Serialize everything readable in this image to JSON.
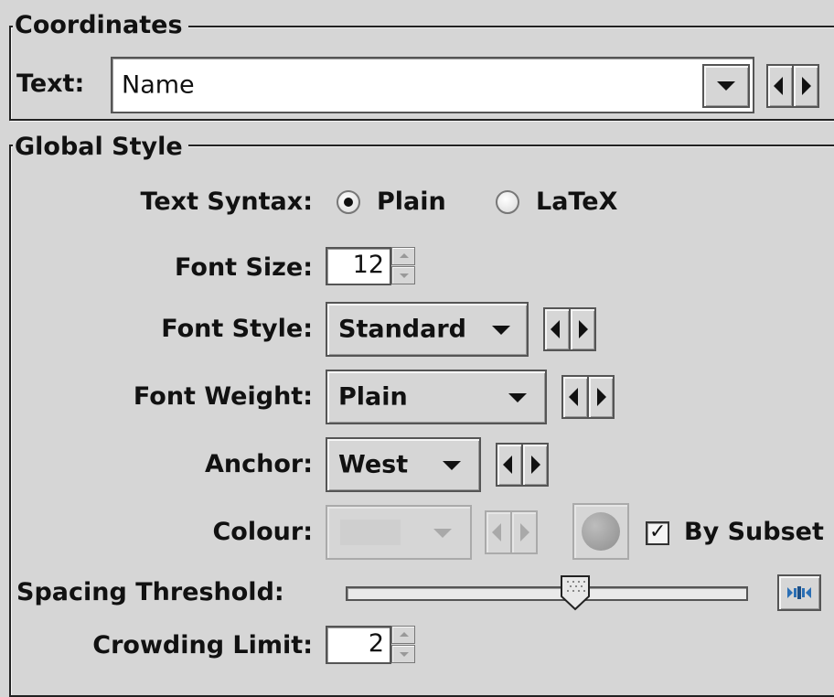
{
  "coordinates": {
    "legend": "Coordinates",
    "text_label": "Text:",
    "text_value": "Name"
  },
  "global_style": {
    "legend": "Global Style",
    "text_syntax": {
      "label": "Text Syntax:",
      "options": [
        {
          "label": "Plain",
          "selected": true
        },
        {
          "label": "LaTeX",
          "selected": false
        }
      ]
    },
    "font_size": {
      "label": "Font Size:",
      "value": "12"
    },
    "font_style": {
      "label": "Font Style:",
      "value": "Standard"
    },
    "font_weight": {
      "label": "Font Weight:",
      "value": "Plain"
    },
    "anchor": {
      "label": "Anchor:",
      "value": "West"
    },
    "colour": {
      "label": "Colour:",
      "enabled": false,
      "by_subset_label": "By Subset",
      "by_subset_checked": true
    },
    "spacing_threshold": {
      "label": "Spacing Threshold:",
      "slider_fraction": 0.57
    },
    "crowding_limit": {
      "label": "Crowding Limit:",
      "value": "2"
    }
  },
  "colors": {
    "panel_bg": "#d6d6d6",
    "field_bg": "#ffffff",
    "disabled": "#a9a9a9",
    "accent_blue": "#2a6fb5"
  },
  "icons": {
    "combo_arrow": "chevron-down-icon",
    "prev": "arrow-left-icon",
    "next": "arrow-right-icon",
    "reset": "slider-reset-icon"
  }
}
